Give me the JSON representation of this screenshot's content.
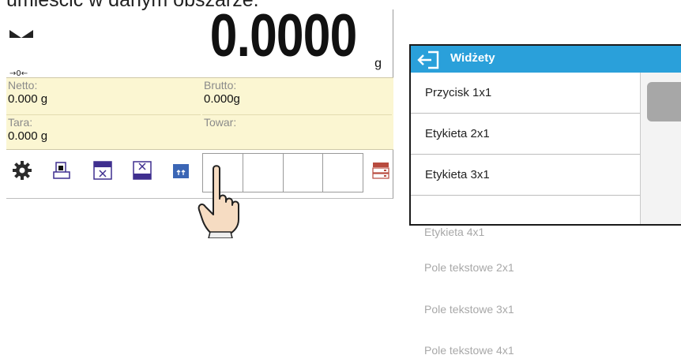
{
  "doc_text": "umieścić w danym obszarze.",
  "scale": {
    "weight": "0.0000",
    "unit": "g",
    "zero_marker": "→0←",
    "info": {
      "netto_label": "Netto:",
      "netto_value": "0.000 g",
      "brutto_label": "Brutto:",
      "brutto_value": "0.000g",
      "tara_label": "Tara:",
      "tara_value": "0.000 g",
      "towar_label": "Towar:",
      "towar_value": ""
    },
    "toolbar_icons": [
      "gear-icon",
      "printer-icon",
      "tare-window-icon",
      "tare-window-icon-2",
      "tare-window-icon-3",
      "mode-icon"
    ],
    "empty_slots": 4,
    "db_icon": "database-icon"
  },
  "dialog": {
    "title": "Widżety",
    "items": [
      "Przycisk 1x1",
      "Etykieta 2x1",
      "Etykieta 3x1"
    ],
    "faded_items": [
      "Etykieta 4x1",
      "Pole tekstowe 2x1",
      "Pole tekstowe 3x1",
      "Pole tekstowe 4x1"
    ]
  },
  "colors": {
    "header": "#2aa0da",
    "info_bg": "#fbf6d2",
    "icon_purple": "#3f2f8f"
  }
}
